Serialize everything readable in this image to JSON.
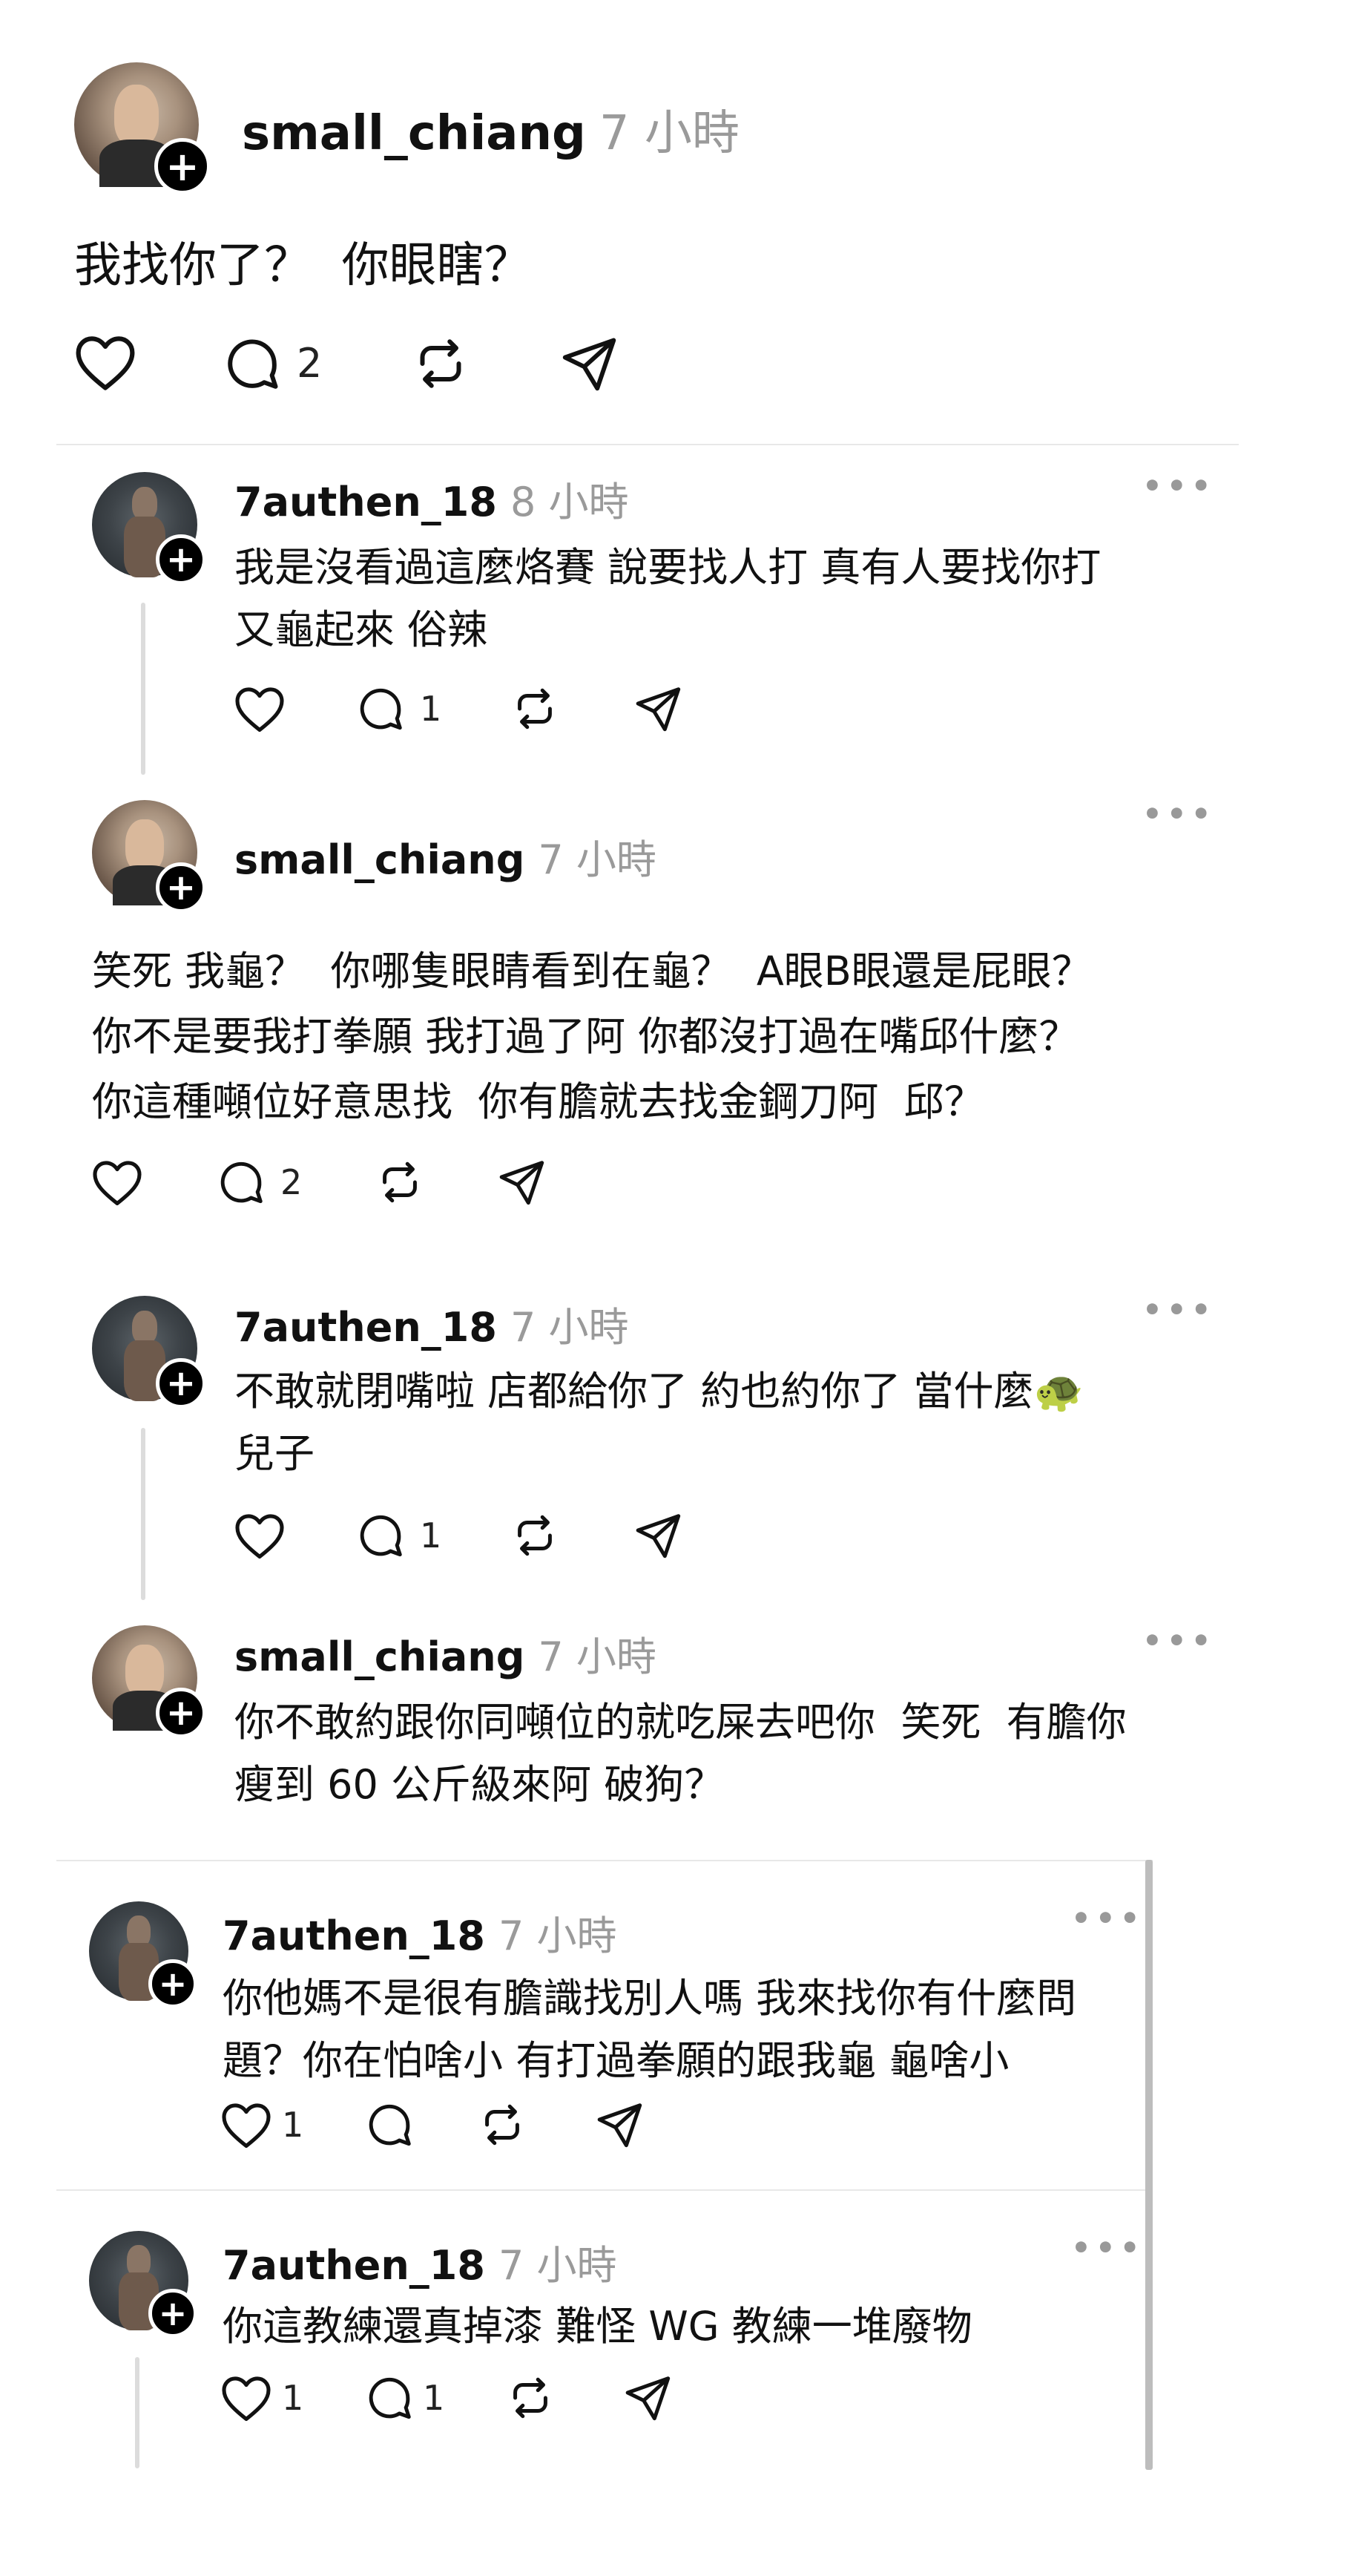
{
  "main_post": {
    "username": "small_chiang",
    "time": "7 小時",
    "text": "我找你了？  你眼瞎？",
    "reply_count": "2"
  },
  "replies": [
    {
      "username": "7authen_18",
      "time": "8 小時",
      "lines": [
        "我是沒看過這麼烙賽 說要找人打 真有人要找你打",
        "又龜起來 俗辣"
      ],
      "like_count": "",
      "reply_count": "1"
    },
    {
      "username": "small_chiang",
      "time": "7 小時",
      "lines": [
        "笑死 我龜？  你哪隻眼睛看到在龜？  A眼B眼還是屁眼？",
        "你不是要我打拳願 我打過了阿 你都沒打過在嘴邱什麼？",
        "你這種噸位好意思找  你有膽就去找金鋼刀阿  邱？"
      ],
      "like_count": "",
      "reply_count": "2"
    },
    {
      "username": "7authen_18",
      "time": "7 小時",
      "lines": [
        "不敢就閉嘴啦 店都給你了 約也約你了 當什麼🐢",
        "兒子"
      ],
      "like_count": "",
      "reply_count": "1"
    },
    {
      "username": "small_chiang",
      "time": "7 小時",
      "lines": [
        "你不敢約跟你同噸位的就吃屎去吧你  笑死  有膽你",
        "瘦到 60 公斤級來阿 破狗？"
      ]
    },
    {
      "username": "7authen_18",
      "time": "7 小時",
      "lines": [
        "你他媽不是很有膽識找別人嗎 我來找你有什麼問",
        "題？你在怕啥小 有打過拳願的跟我龜 龜啥小"
      ],
      "like_count": "1",
      "reply_count": ""
    },
    {
      "username": "7authen_18",
      "time": "7 小時",
      "lines": [
        "你這教練還真掉漆 難怪 WG 教練一堆廢物"
      ],
      "like_count": "1",
      "reply_count": "1"
    }
  ],
  "icons": {
    "like": "heart-icon",
    "reply": "speech-bubble-icon",
    "repost": "repost-icon",
    "share": "paper-plane-icon",
    "more": "more-dots-icon",
    "follow": "plus-icon"
  },
  "colors": {
    "text": "#111111",
    "muted": "#9a9a9a",
    "divider": "#e8e8e8"
  }
}
